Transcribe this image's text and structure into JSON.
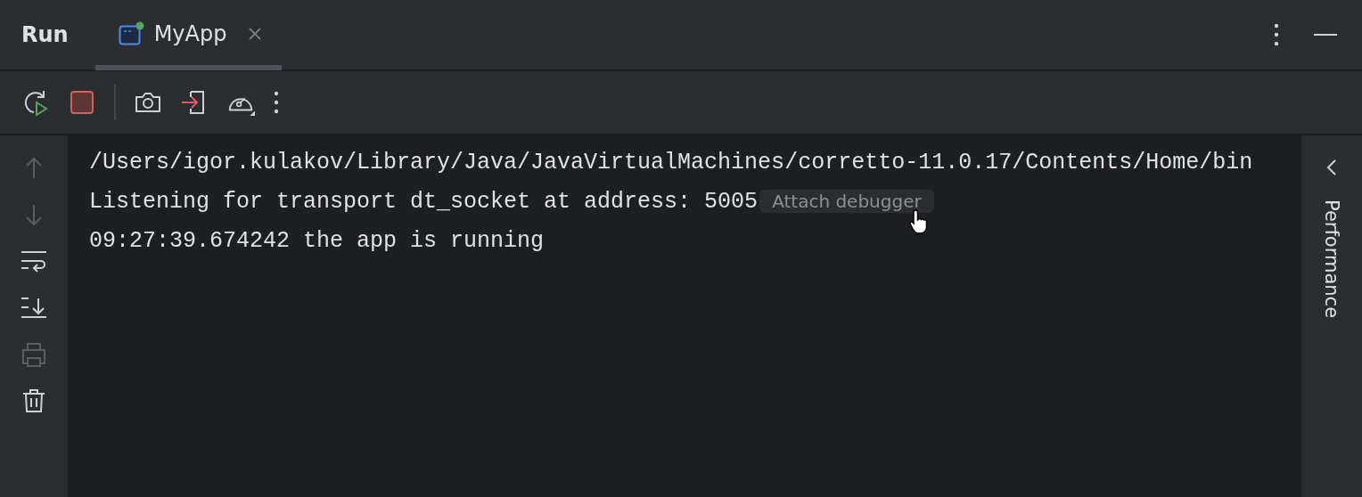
{
  "tool_window": {
    "title": "Run"
  },
  "tabs": [
    {
      "label": "MyApp",
      "selected": true,
      "running": true,
      "closable": true
    }
  ],
  "toolbar": [
    {
      "kind": "rerun",
      "disabled": false
    },
    {
      "kind": "stop",
      "disabled": false
    },
    {
      "kind": "separator"
    },
    {
      "kind": "camera",
      "disabled": false
    },
    {
      "kind": "import",
      "disabled": false
    },
    {
      "kind": "gauge",
      "disabled": false
    },
    {
      "kind": "more",
      "disabled": false
    }
  ],
  "sidebar": [
    {
      "kind": "up",
      "disabled": true
    },
    {
      "kind": "down",
      "disabled": true
    },
    {
      "kind": "wrap",
      "disabled": false
    },
    {
      "kind": "scroll-end",
      "disabled": false
    },
    {
      "kind": "print",
      "disabled": true
    },
    {
      "kind": "trash",
      "disabled": false
    }
  ],
  "console": [
    {
      "text": "/Users/igor.kulakov/Library/Java/JavaVirtualMachines/corretto-11.0.17/Contents/Home/bin"
    },
    {
      "text": "Listening for transport dt_socket at address: 5005",
      "link": "Attach debugger"
    },
    {
      "text": "09:27:39.674242 the app is running"
    }
  ],
  "side_panel": {
    "label": "Performance"
  }
}
